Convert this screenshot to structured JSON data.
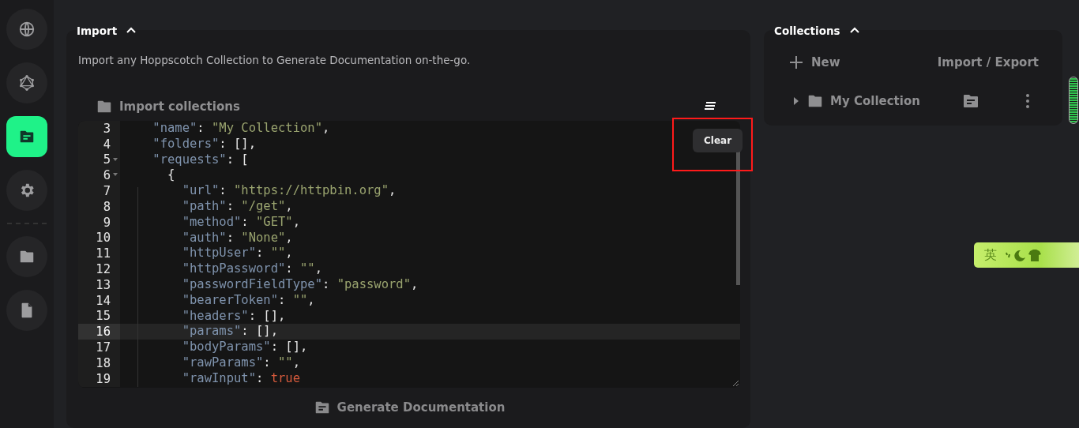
{
  "sidebar": {
    "items": [
      {
        "selected": false
      },
      {
        "selected": false
      },
      {
        "selected": true
      },
      {
        "selected": false
      },
      {
        "selected": false
      },
      {
        "selected": false
      }
    ]
  },
  "import_section": {
    "title": "Import",
    "expanded": true,
    "description": "Import any Hoppscotch Collection to Generate Documentation on-the-go.",
    "import_label": "Import collections",
    "tooltip": "Clear",
    "editor": {
      "lines": [
        {
          "number": "3",
          "text": "    \"name\": \"My Collection\",",
          "foldable": false,
          "active": false
        },
        {
          "number": "4",
          "text": "    \"folders\": [],",
          "foldable": false,
          "active": false
        },
        {
          "number": "5",
          "text": "    \"requests\": [",
          "foldable": true,
          "active": false
        },
        {
          "number": "6",
          "text": "      {",
          "foldable": true,
          "active": false
        },
        {
          "number": "7",
          "text": "        \"url\": \"https://httpbin.org\",",
          "foldable": false,
          "active": false
        },
        {
          "number": "8",
          "text": "        \"path\": \"/get\",",
          "foldable": false,
          "active": false
        },
        {
          "number": "9",
          "text": "        \"method\": \"GET\",",
          "foldable": false,
          "active": false
        },
        {
          "number": "10",
          "text": "        \"auth\": \"None\",",
          "foldable": false,
          "active": false
        },
        {
          "number": "11",
          "text": "        \"httpUser\": \"\",",
          "foldable": false,
          "active": false
        },
        {
          "number": "12",
          "text": "        \"httpPassword\": \"\",",
          "foldable": false,
          "active": false
        },
        {
          "number": "13",
          "text": "        \"passwordFieldType\": \"password\",",
          "foldable": false,
          "active": false
        },
        {
          "number": "14",
          "text": "        \"bearerToken\": \"\",",
          "foldable": false,
          "active": false
        },
        {
          "number": "15",
          "text": "        \"headers\": [],",
          "foldable": false,
          "active": false
        },
        {
          "number": "16",
          "text": "        \"params\": [],",
          "foldable": false,
          "active": true
        },
        {
          "number": "17",
          "text": "        \"bodyParams\": [],",
          "foldable": false,
          "active": false
        },
        {
          "number": "18",
          "text": "        \"rawParams\": \"\",",
          "foldable": false,
          "active": false
        },
        {
          "number": "19",
          "text": "        \"rawInput\": true",
          "foldable": false,
          "active": false
        }
      ]
    },
    "generate_button": "Generate Documentation"
  },
  "collections": {
    "title": "Collections",
    "expanded": true,
    "new_button": "New",
    "import_export": "Import / Export",
    "items": [
      {
        "name": "My Collection",
        "expanded": false
      }
    ]
  },
  "ime_toolbar": {
    "label": "英"
  }
}
